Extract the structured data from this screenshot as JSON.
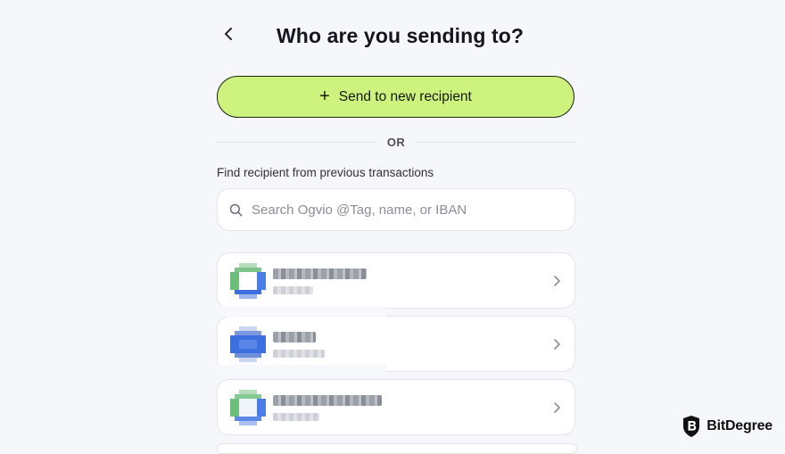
{
  "header": {
    "title": "Who are you sending to?",
    "back_icon": "chevron-left-icon"
  },
  "primary_action": {
    "label": "Send to new recipient",
    "icon": "plus-icon"
  },
  "divider": {
    "label": "OR"
  },
  "search": {
    "section_label": "Find recipient from previous transactions",
    "placeholder": "Search Ogvio @Tag, name, or IBAN",
    "value": ""
  },
  "recipients": [
    {
      "avatar_colors": [
        "#6bbf7a",
        "#3d6fe0"
      ],
      "note": "blurred"
    },
    {
      "avatar_colors": [
        "#3d6fe0",
        "#6f8fd8"
      ],
      "note": "blurred"
    },
    {
      "avatar_colors": [
        "#6bbf7a",
        "#3d6fe0"
      ],
      "note": "blurred"
    }
  ],
  "watermark": {
    "brand": "BitDegree"
  },
  "colors": {
    "accent": "#cdf27d",
    "background": "#f6f7fb",
    "text": "#14161f"
  }
}
